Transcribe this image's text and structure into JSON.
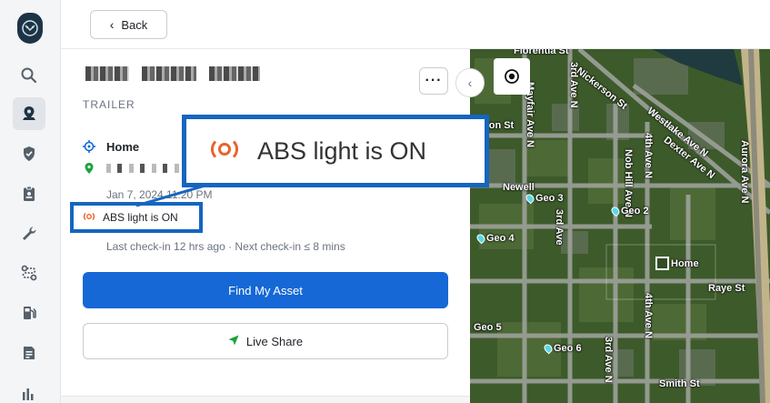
{
  "topbar": {
    "back_label": "Back"
  },
  "sidebar": {
    "items": [
      {
        "name": "search-icon"
      },
      {
        "name": "map-pin-icon",
        "active": true
      },
      {
        "name": "shield-icon"
      },
      {
        "name": "clipboard-icon"
      },
      {
        "name": "wrench-icon"
      },
      {
        "name": "route-icon"
      },
      {
        "name": "fuel-icon"
      },
      {
        "name": "document-icon"
      },
      {
        "name": "chart-icon"
      }
    ]
  },
  "panel": {
    "asset_type": "TRAILER",
    "location_name": "Home",
    "date": "Jan 7, 2024 11:20 PM",
    "alert": "ABS light is ON",
    "checkin": "Last check-in 12 hrs ago · Next check-in ≤ 8 mins",
    "primary_button": "Find My Asset",
    "secondary_button": "Live Share",
    "more_label": "···",
    "collapse_label": "‹"
  },
  "callout": {
    "text": "ABS light is ON"
  },
  "map": {
    "streets": {
      "florentia": "Florentia St",
      "nickerson": "Nickerson St",
      "westlake": "Westlake Ave N",
      "dexter": "Dexter Ave N",
      "aurora": "Aurora Ave N",
      "fulton": "lton St",
      "newell": "Newell",
      "third_n": "3rd Ave N",
      "mayfair": "Mayfair Ave N",
      "nob_hill": "Nob Hill Ave N",
      "fourth_top": "4th Ave N",
      "third_mid": "3rd Ave",
      "raye": "Raye St",
      "smith": "Smith St",
      "fourth_mid": "4th Ave N",
      "third_bot": "3rd Ave N"
    },
    "geofences": [
      "Geo 3",
      "Geo 2",
      "Geo 4",
      "Geo 5",
      "Geo 6"
    ],
    "home_label": "Home"
  },
  "colors": {
    "primary": "#1568d6",
    "alert": "#e8642c",
    "callout_border": "#1565c0"
  }
}
